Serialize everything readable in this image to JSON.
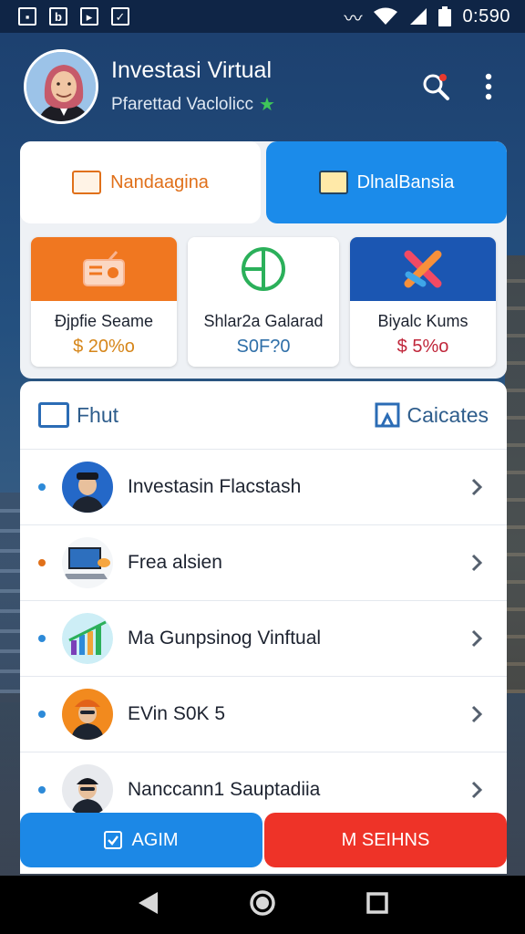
{
  "status_bar": {
    "icons": [
      "square-icon",
      "b-icon",
      "play-icon",
      "check-icon"
    ],
    "right_icons": [
      "vibrate-icon",
      "wifi-icon",
      "signal-icon",
      "battery-icon"
    ],
    "time": "0:590"
  },
  "header": {
    "title": "Investasi Virtual",
    "subtitle": "Pfarettad Vaclolicc",
    "search_icon": "search-icon",
    "menu_icon": "more-vert-icon"
  },
  "tabs": {
    "left_label": "Nandaagina",
    "right_label": "DlnalBansia",
    "active": "right"
  },
  "products": [
    {
      "name": "Đjpfie Seame",
      "value": "$ 20%o"
    },
    {
      "name": "Shlar2a Galarad",
      "value": "S0F?0"
    },
    {
      "name": "Biyalc Kums",
      "value": "$ 5%o"
    }
  ],
  "list_header": {
    "left_label": "Fhut",
    "right_label": "Caicates"
  },
  "list_items": [
    {
      "label": "Investasin Flacstash",
      "dot_color": "#2d8ad8"
    },
    {
      "label": "Frea alsien",
      "dot_color": "#e0701a"
    },
    {
      "label": "Ma Gunpsinog Vinftual",
      "dot_color": "#2d8ad8"
    },
    {
      "label": "EVin S0K 5",
      "dot_color": "#2d8ad8"
    },
    {
      "label": "Nanccann1 Sauptadiia",
      "dot_color": "#2d8ad8"
    }
  ],
  "actions": {
    "left_label": "AGIM",
    "right_label": "M SEIHNS"
  },
  "colors": {
    "accent_blue": "#1b8bea",
    "accent_orange": "#f07720",
    "accent_red": "#ee3328",
    "header_bg": "#1c3f6e"
  }
}
